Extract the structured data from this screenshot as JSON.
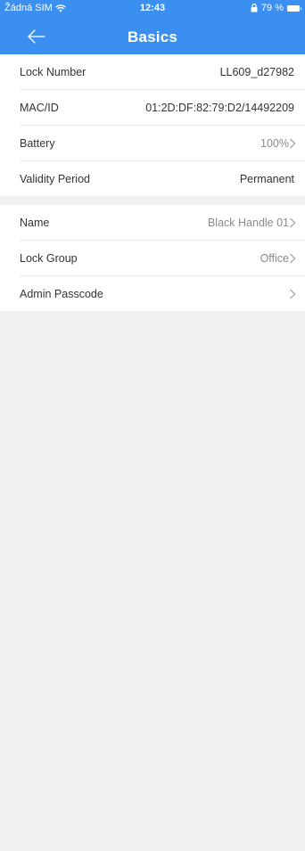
{
  "status_bar": {
    "carrier": "Žádná SIM",
    "time": "12:43",
    "battery_percent": "79 %"
  },
  "nav": {
    "title": "Basics"
  },
  "section1": [
    {
      "label": "Lock Number",
      "value": "LL609_d27982"
    },
    {
      "label": "MAC/ID",
      "value": "01:2D:DF:82:79:D2/14492209"
    },
    {
      "label": "Battery",
      "value": "100%"
    },
    {
      "label": "Validity Period",
      "value": "Permanent"
    }
  ],
  "section2": [
    {
      "label": "Name",
      "value": "Black Handle 01"
    },
    {
      "label": "Lock Group",
      "value": "Office"
    },
    {
      "label": "Admin Passcode",
      "value": ""
    }
  ],
  "colors": {
    "header": "#3b8ff1",
    "background": "#f0f0f0",
    "muted_text": "#8a8a8a"
  }
}
